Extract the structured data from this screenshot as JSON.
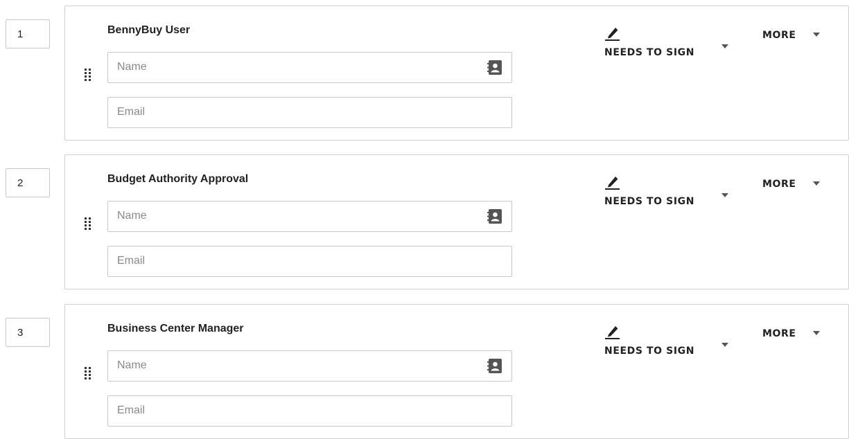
{
  "recipients": [
    {
      "order": "1",
      "role": "BennyBuy User",
      "name_placeholder": "Name",
      "email_placeholder": "Email",
      "name_value": "",
      "email_value": "",
      "action_label": "NEEDS TO SIGN",
      "more_label": "MORE",
      "action_icon": "pen-icon"
    },
    {
      "order": "2",
      "role": "Budget Authority Approval",
      "name_placeholder": "Name",
      "email_placeholder": "Email",
      "name_value": "",
      "email_value": "",
      "action_label": "NEEDS TO SIGN",
      "more_label": "MORE",
      "action_icon": "pen-icon"
    },
    {
      "order": "3",
      "role": "Business Center Manager",
      "name_placeholder": "Name",
      "email_placeholder": "Email",
      "name_value": "",
      "email_value": "",
      "action_label": "NEEDS TO SIGN",
      "more_label": "MORE",
      "action_icon": "pen-icon"
    }
  ],
  "colors": {
    "text": "#222222",
    "border": "#cfcfcf",
    "placeholder": "#8a8a8a",
    "icon": "#555555"
  }
}
